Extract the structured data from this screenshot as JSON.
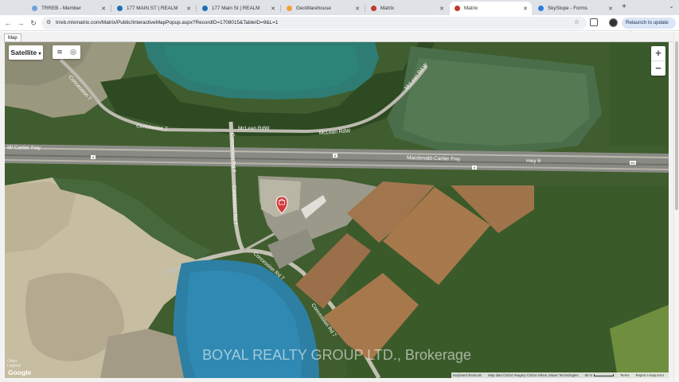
{
  "tabs": [
    {
      "title": "TRREB - Member",
      "fav": "#6fa3d8"
    },
    {
      "title": "177 MAIN ST | REALM",
      "fav": "#1f6fb5"
    },
    {
      "title": "177 Main St | REALM",
      "fav": "#1f6fb5"
    },
    {
      "title": "GeoWarehouse",
      "fav": "#f0a23a"
    },
    {
      "title": "Matrix",
      "fav": "#c0392b"
    },
    {
      "title": "Matrix",
      "fav": "#c0392b"
    },
    {
      "title": "SkySlope - Forms",
      "fav": "#2a7de1"
    }
  ],
  "active_tab_index": 5,
  "address_bar": {
    "url": "trreb.mlxmatrix.com/Matrix/Public/InteractiveMapPopup.aspx?RecordID=1708015&TableID=9&L=1"
  },
  "relaunch_label": "Relaunch to update",
  "map": {
    "tab_label": "Map",
    "map_type": "Satellite",
    "road_labels": [
      "Concession 7",
      "McLean RdW",
      "McLean RdW",
      "McLean Rd W",
      "Idl Cartier Fwy",
      "Macdonald-Cartier Fwy",
      "Hwy 6",
      "Concession Rd 7",
      "Concession Rd 7",
      "Concession Rd 7",
      "Concession Rd 7"
    ],
    "shields": [
      "6",
      "6",
      "6",
      "6",
      "401"
    ],
    "watermark": "BOYAL REALTY GROUP LTD., Brokerage",
    "legend_lines": [
      "Outer",
      "Legend"
    ],
    "google_logo": "Google",
    "attribution": {
      "shortcuts": "Keyboard shortcuts",
      "data": "Map data ©2024 Imagery ©2024 Airbus, Maxar Technologies",
      "scale": "50 m",
      "terms": "Terms",
      "report": "Report a map error"
    }
  },
  "colors": {
    "accent": "#dbe6f6",
    "marker": "#d23a3a"
  }
}
